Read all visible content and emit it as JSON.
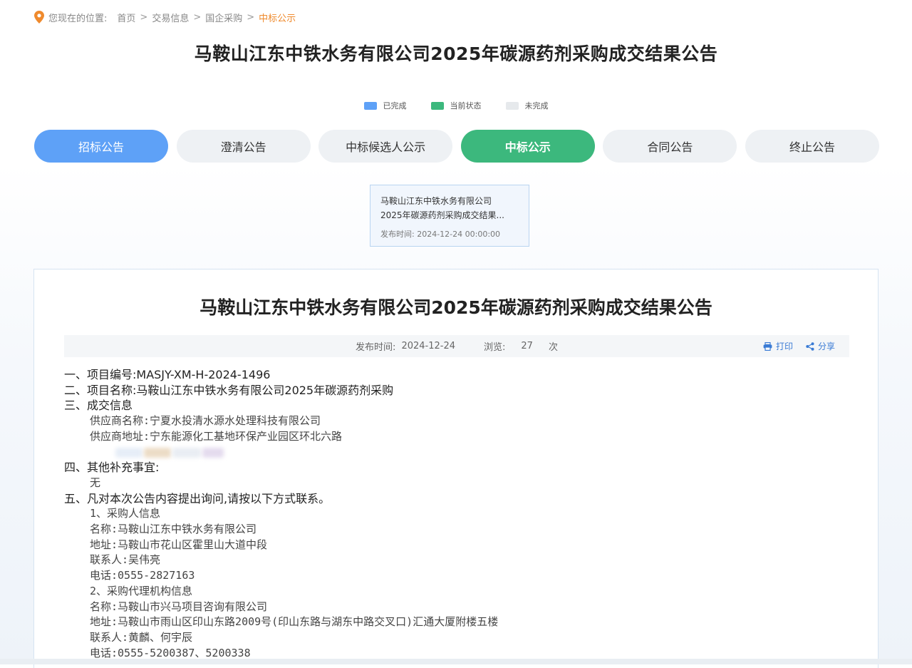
{
  "breadcrumb": {
    "prefix": "您现在的位置:",
    "items": [
      "首页",
      "交易信息",
      "国企采购"
    ],
    "current": "中标公示"
  },
  "page_title": "马鞍山江东中铁水务有限公司2025年碳源药剂采购成交结果公告",
  "legend": [
    {
      "label": "已完成",
      "color": "#5ea1f7"
    },
    {
      "label": "当前状态",
      "color": "#3cb87d"
    },
    {
      "label": "未完成",
      "color": "#e6e9ec"
    }
  ],
  "steps": [
    {
      "label": "招标公告",
      "state": "done"
    },
    {
      "label": "澄清公告",
      "state": "pending"
    },
    {
      "label": "中标候选人公示",
      "state": "pending"
    },
    {
      "label": "中标公示",
      "state": "current"
    },
    {
      "label": "合同公告",
      "state": "pending"
    },
    {
      "label": "终止公告",
      "state": "pending"
    }
  ],
  "notice_card": {
    "title_line1": "马鞍山江东中铁水务有限公司",
    "title_line2": "2025年碳源药剂采购成交结果...",
    "date_label": "发布时间:",
    "date": "2024-12-24 00:00:00"
  },
  "article": {
    "title": "马鞍山江东中铁水务有限公司2025年碳源药剂采购成交结果公告",
    "publish_label": "发布时间:",
    "publish_date": "2024-12-24",
    "views_label": "浏览:",
    "views_count": "27",
    "views_unit": "次",
    "print_label": "打印",
    "share_label": "分享",
    "sections": {
      "s1": "一、项目编号:MASJY-XM-H-2024-1496",
      "s2": "二、项目名称:马鞍山江东中铁水务有限公司2025年碳源药剂采购",
      "s3": "三、成交信息",
      "supplier_name": "供应商名称:宁夏水投清水源水处理科技有限公司",
      "supplier_addr": "供应商地址:宁东能源化工基地环保产业园区环北六路",
      "s4": "四、其他补充事宜:",
      "s4_body": "无",
      "s5": "五、凡对本次公告内容提出询问,请按以下方式联系。",
      "buyer_head": "1、采购人信息",
      "buyer_name": "名称:马鞍山江东中铁水务有限公司",
      "buyer_addr": "地址:马鞍山市花山区霍里山大道中段",
      "buyer_contact": "联系人:吴伟亮",
      "buyer_phone": "电话:0555-2827163",
      "agent_head": "2、采购代理机构信息",
      "agent_name": "名称:马鞍山市兴马项目咨询有限公司",
      "agent_addr": "地址:马鞍山市雨山区印山东路2009号(印山东路与湖东中路交叉口)汇通大厦附楼五楼",
      "agent_contact": "联系人:黄麟、何宇辰",
      "agent_phone": "电话:0555-5200387、5200338"
    }
  }
}
